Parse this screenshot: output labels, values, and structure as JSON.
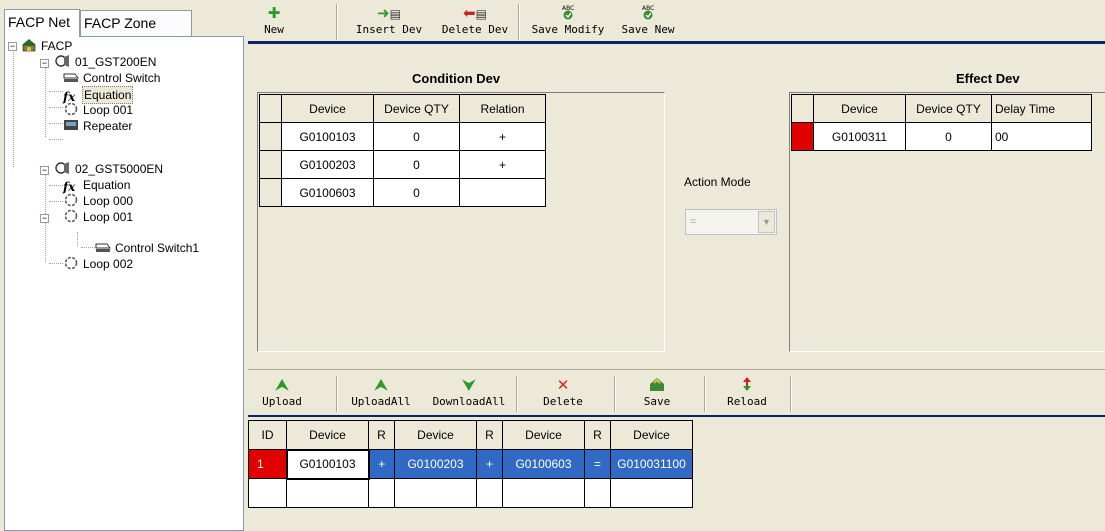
{
  "tabs": [
    {
      "label": "FACP Net"
    },
    {
      "label": "FACP Zone"
    }
  ],
  "tree": {
    "root": "FACP",
    "nodes": [
      {
        "label": "01_GST200EN"
      },
      {
        "label": "Control Switch"
      },
      {
        "label": "Equation"
      },
      {
        "label": "Loop 001"
      },
      {
        "label": "Repeater"
      },
      {
        "label": "02_GST5000EN"
      },
      {
        "label": "Equation"
      },
      {
        "label": "Loop 000"
      },
      {
        "label": "Loop 001"
      },
      {
        "label": "Control Switch1"
      },
      {
        "label": "Loop 002"
      }
    ],
    "expanders": [
      "−",
      "−",
      "−",
      "−"
    ]
  },
  "toolbar": {
    "new": "New",
    "insert_dev": "Insert Dev",
    "delete_dev": "Delete Dev",
    "save_modify": "Save Modify",
    "save_new": "Save New",
    "abc": "ABC"
  },
  "condition": {
    "title": "Condition Dev",
    "headers": [
      "Device",
      "Device QTY",
      "Relation"
    ],
    "rows": [
      [
        "G0100103",
        "0",
        "+"
      ],
      [
        "G0100203",
        "0",
        "+"
      ],
      [
        "G0100603",
        "0",
        ""
      ]
    ]
  },
  "action_mode": {
    "label": "Action Mode",
    "value": "=",
    "arrow": "▼"
  },
  "effect": {
    "title": "Effect Dev",
    "headers": [
      "Device",
      "Device QTY",
      "Delay Time"
    ],
    "rows": [
      [
        "G0100311",
        "0",
        "00"
      ]
    ]
  },
  "toolbar2": {
    "upload": "Upload",
    "upload_all": "UploadAll",
    "download_all": "DownloadAll",
    "delete": "Delete",
    "save": "Save",
    "reload": "Reload"
  },
  "bottom_grid": {
    "headers": [
      "ID",
      "Device",
      "R",
      "Device",
      "R",
      "Device",
      "R",
      "Device"
    ],
    "rows": [
      [
        "1",
        "G0100103",
        "+",
        "G0100203",
        "+",
        "G0100603",
        "=",
        "G010031100"
      ],
      [
        "",
        "",
        "",
        "",
        "",
        "",
        "",
        ""
      ]
    ]
  },
  "colors": {
    "selected_blue": "#316ac5",
    "row_marker_red": "#e00000",
    "accent_bar": "#0a246a",
    "window_bg": "#ece9d8"
  }
}
